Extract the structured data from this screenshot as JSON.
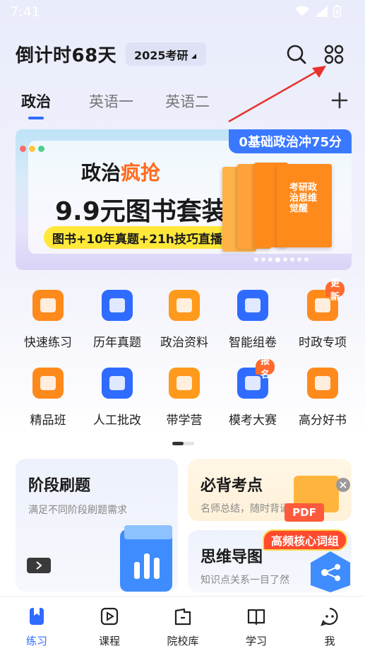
{
  "status_bar": {
    "time": "7:41"
  },
  "header": {
    "countdown": "倒计时68天",
    "year_select": "2025考研"
  },
  "tabs": [
    {
      "label": "政治",
      "active": true
    },
    {
      "label": "英语一",
      "active": false
    },
    {
      "label": "英语二",
      "active": false
    }
  ],
  "banner": {
    "tag": "0基础政治冲75分",
    "line1_a": "政治",
    "line1_b": "疯抢",
    "line2": "9.9元图书套装",
    "pill": "图书+10年真题+21h技巧直播",
    "book_title": "考研政治思维觉醒",
    "indicator_count": 8,
    "indicator_active": 3
  },
  "grid": [
    {
      "label": "快速练习",
      "icon": "quick-practice-icon",
      "color": "#ff8a1c",
      "badge": ""
    },
    {
      "label": "历年真题",
      "icon": "past-exams-icon",
      "color": "#2f6bff",
      "badge": ""
    },
    {
      "label": "政治资料",
      "icon": "materials-icon",
      "color": "#ff9a1c",
      "badge": ""
    },
    {
      "label": "智能组卷",
      "icon": "ai-paper-icon",
      "color": "#2f6bff",
      "badge": ""
    },
    {
      "label": "时政专项",
      "icon": "current-affairs-icon",
      "color": "#ff8a1c",
      "badge": "更新"
    },
    {
      "label": "精品班",
      "icon": "premium-class-icon",
      "color": "#ff8a1c",
      "badge": ""
    },
    {
      "label": "人工批改",
      "icon": "manual-grading-icon",
      "color": "#2f6bff",
      "badge": ""
    },
    {
      "label": "带学营",
      "icon": "study-camp-icon",
      "color": "#ff9a1c",
      "badge": ""
    },
    {
      "label": "模考大赛",
      "icon": "mock-contest-icon",
      "color": "#2f6bff",
      "badge": "报名"
    },
    {
      "label": "高分好书",
      "icon": "good-books-icon",
      "color": "#ff8a1c",
      "badge": ""
    }
  ],
  "cards": {
    "stage_practice": {
      "title": "阶段刷题",
      "subtitle": "满足不同阶段刷题需求"
    },
    "key_points": {
      "title": "必背考点",
      "subtitle": "名师总结，随时背诵",
      "file_tag": "PDF"
    },
    "mind_map": {
      "title": "思维导图",
      "subtitle": "知识点关系一目了然"
    },
    "popup_tag": "高频核心词组"
  },
  "bottom_nav": [
    {
      "label": "练习",
      "icon": "practice-icon",
      "active": true
    },
    {
      "label": "课程",
      "icon": "course-icon",
      "active": false
    },
    {
      "label": "院校库",
      "icon": "school-db-icon",
      "active": false
    },
    {
      "label": "学习",
      "icon": "study-icon",
      "active": false
    },
    {
      "label": "我",
      "icon": "me-icon",
      "active": false
    }
  ],
  "colors": {
    "accent": "#2f6bff",
    "orange": "#ff8a1c",
    "badge": "#ff6a2e"
  }
}
